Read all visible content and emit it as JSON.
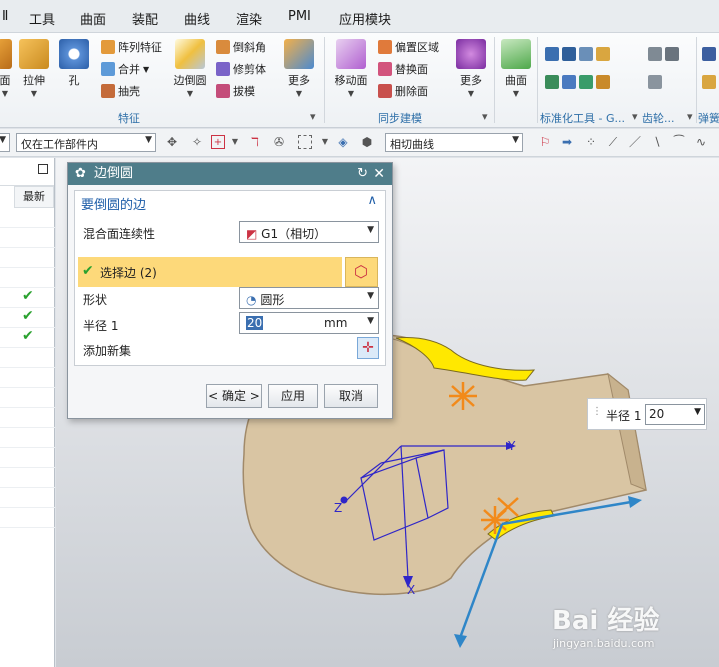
{
  "menubar": {
    "items": [
      "Ⅱ",
      "工具",
      "曲面",
      "装配",
      "曲线",
      "渲染",
      "PMI",
      "应用模块"
    ]
  },
  "ribbon": {
    "feature_group": {
      "label": "特征",
      "buttons": {
        "face": "面",
        "extrude": "拉伸",
        "hole": "孔",
        "edge_blend": "边倒圆",
        "more": "更多"
      },
      "small": {
        "pattern": "阵列特征",
        "unite": "合并",
        "shell": "抽壳",
        "chamfer": "倒斜角",
        "trim_body": "修剪体",
        "draft": "拔模"
      }
    },
    "sync_group": {
      "label": "同步建模",
      "buttons": {
        "move_face": "移动面",
        "more": "更多"
      },
      "small": {
        "offset_region": "偏置区域",
        "replace_face": "替换面",
        "delete_face": "删除面"
      }
    },
    "surface_group": {
      "buttons": {
        "surface": "曲面"
      }
    },
    "std_group": {
      "label": "标准化工具 - G..."
    },
    "gear_group": {
      "label": "齿轮..."
    },
    "spring_group": {
      "label": "弹簧"
    }
  },
  "filterbar": {
    "scope_combo": "仅在工作部件内",
    "curve_rule_combo": "相切曲线"
  },
  "navigator": {
    "column_header": "最新",
    "check_glyph": "✔"
  },
  "dialog": {
    "title": "边倒圆",
    "section_title": "要倒圆的边",
    "continuity_label": "混合面连续性",
    "continuity_value": "G1（相切）",
    "select_edge_label": "选择边 (2)",
    "shape_label": "形状",
    "shape_value": "圆形",
    "radius_label": "半径 1",
    "radius_value": "20",
    "radius_unit": "mm",
    "add_set_label": "添加新集",
    "ok_label": "< 确定 >",
    "apply_label": "应用",
    "cancel_label": "取消"
  },
  "viewport": {
    "radius_label": "半径 1",
    "radius_value": "20",
    "axis_y": "Y",
    "axis_z": "Z",
    "axis_x": "X"
  },
  "watermark": {
    "brand": "Bai 经验",
    "url": "jingyan.baidu.com"
  },
  "colors": {
    "dialog_title": "#4f7d8a",
    "selection_row": "#fdd97a",
    "section_blue": "#1f5ea8",
    "part_face": "#d9c5a3",
    "blend_highlight": "#ffe800",
    "csys": "#2f26c8",
    "arrow": "#2f86c8"
  }
}
